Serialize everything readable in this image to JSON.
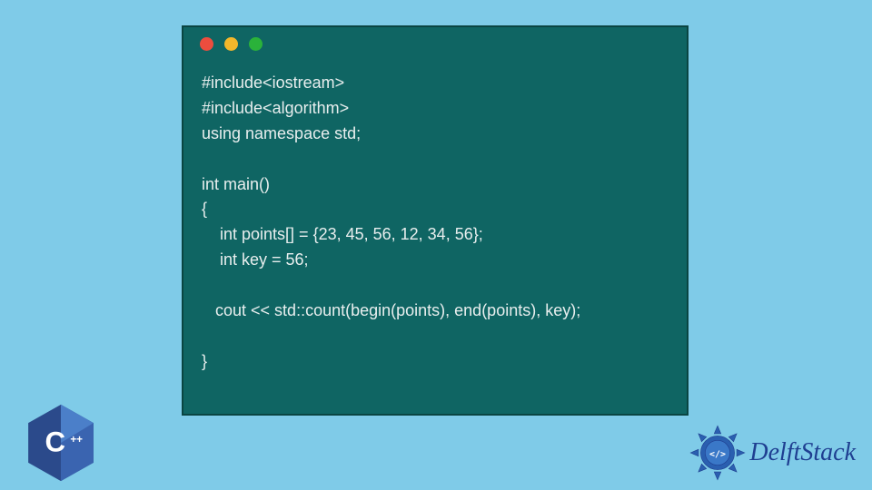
{
  "code": {
    "line1": "#include<iostream>",
    "line2": "#include<algorithm>",
    "line3": "using namespace std;",
    "line4": "",
    "line5": "int main()",
    "line6": "{",
    "line7": "    int points[] = {23, 45, 56, 12, 34, 56};",
    "line8": "    int key = 56;",
    "line9": "",
    "line10": "   cout << std::count(begin(points), end(points), key);",
    "line11": "",
    "line12": "}"
  },
  "brand": {
    "name": "DelftStack",
    "lang": "C++"
  },
  "colors": {
    "bg": "#7fcbe8",
    "window": "#0f6563",
    "red": "#ec4d3e",
    "yellow": "#f3b72b",
    "green": "#2ab23a",
    "brandBlue": "#1f3f91"
  }
}
